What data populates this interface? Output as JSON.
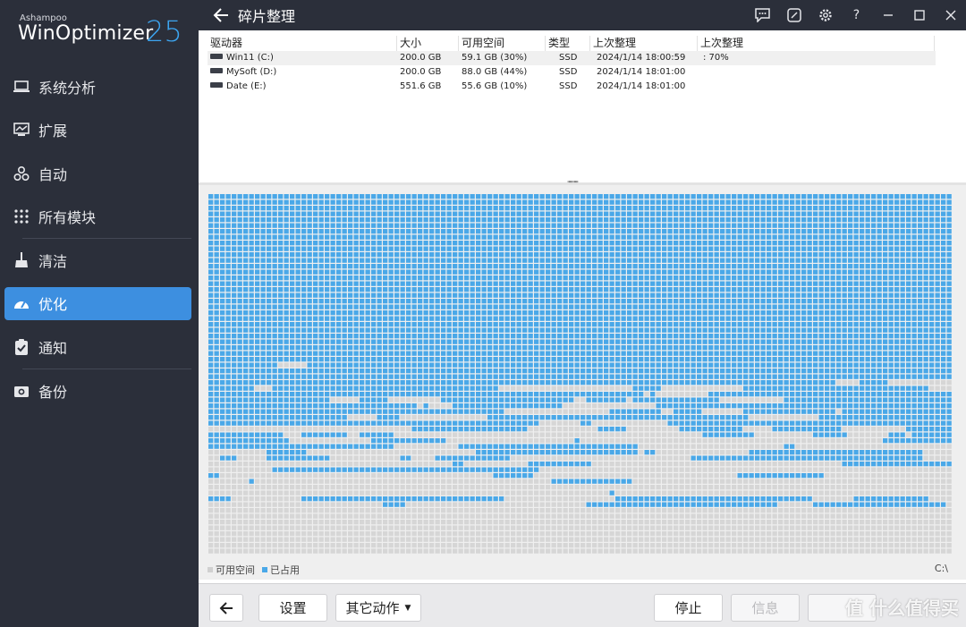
{
  "brand": {
    "small": "Ashampoo",
    "name": "WinOptimizer",
    "version": "25"
  },
  "sidebar": {
    "items": [
      {
        "label": "系统分析",
        "icon": "laptop-icon"
      },
      {
        "label": "扩展",
        "icon": "chart-screen-icon"
      },
      {
        "label": "自动",
        "icon": "link-nodes-icon"
      },
      {
        "label": "所有模块",
        "icon": "grid-dots-icon"
      },
      {
        "label": "清洁",
        "icon": "broom-icon"
      },
      {
        "label": "优化",
        "icon": "gauge-icon"
      },
      {
        "label": "通知",
        "icon": "clipboard-check-icon"
      },
      {
        "label": "备份",
        "icon": "camera-icon"
      }
    ],
    "active": "优化"
  },
  "header": {
    "title": "碎片整理"
  },
  "table": {
    "columns": [
      "驱动器",
      "大小",
      "可用空间",
      "类型",
      "上次整理",
      "上次整理"
    ],
    "rows": [
      {
        "drive": "Win11 (C:)",
        "size": "200.0 GB",
        "free": "59.1 GB (30%)",
        "type": "SSD",
        "last": "2024/1/14 18:00:59",
        "progress": ": 70%"
      },
      {
        "drive": "MySoft (D:)",
        "size": "200.0 GB",
        "free": "88.0 GB (44%)",
        "type": "SSD",
        "last": "2024/1/14 18:01:00",
        "progress": ""
      },
      {
        "drive": "Date (E:)",
        "size": "551.6 GB",
        "free": "55.6 GB (10%)",
        "type": "SSD",
        "last": "2024/1/14 18:01:00",
        "progress": ""
      }
    ]
  },
  "legend": {
    "free": "可用空间",
    "used": "已占用"
  },
  "map": {
    "drive": "C:\\",
    "used_color": "#4aa8e8",
    "free_color": "#d6d6d6"
  },
  "footer": {
    "settings": "设置",
    "more": "其它动作",
    "stop": "停止",
    "info": "信息"
  },
  "watermark": "值 什么值得买",
  "colors": {
    "sidebar_bg": "#2b2f3a",
    "accent": "#3d8fe0"
  }
}
